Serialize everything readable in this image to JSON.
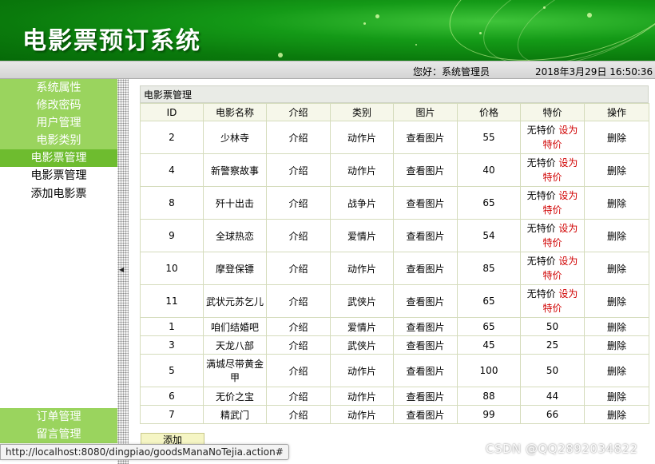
{
  "header": {
    "title": "电影票预订系统"
  },
  "infobar": {
    "greeting": "您好：系统管理员",
    "datetime": "2018年3月29日 16:50:36"
  },
  "sidebar": {
    "items": [
      {
        "label": "系统属性"
      },
      {
        "label": "修改密码"
      },
      {
        "label": "用户管理"
      },
      {
        "label": "电影类别"
      },
      {
        "label": "电影票管理"
      }
    ],
    "subitems": [
      {
        "label": "电影票管理"
      },
      {
        "label": "添加电影票"
      }
    ],
    "bottom_items": [
      {
        "label": "订单管理"
      },
      {
        "label": "留言管理"
      }
    ]
  },
  "main": {
    "section_title": "电影票管理",
    "columns": [
      "ID",
      "电影名称",
      "介绍",
      "类别",
      "图片",
      "价格",
      "特价",
      "操作"
    ],
    "intro_link": "介绍",
    "image_link": "查看图片",
    "no_special": "无特价",
    "set_special": "设为特价",
    "delete_link": "删除",
    "rows": [
      {
        "id": "2",
        "name": "少林寺",
        "category": "动作片",
        "price": "55",
        "special": ""
      },
      {
        "id": "4",
        "name": "新警察故事",
        "category": "动作片",
        "price": "40",
        "special": ""
      },
      {
        "id": "8",
        "name": "歼十出击",
        "category": "战争片",
        "price": "65",
        "special": ""
      },
      {
        "id": "9",
        "name": "全球热恋",
        "category": "爱情片",
        "price": "54",
        "special": ""
      },
      {
        "id": "10",
        "name": "摩登保镖",
        "category": "动作片",
        "price": "85",
        "special": ""
      },
      {
        "id": "11",
        "name": "武状元苏乞儿",
        "category": "武侠片",
        "price": "65",
        "special": ""
      },
      {
        "id": "1",
        "name": "咱们结婚吧",
        "category": "爱情片",
        "price": "65",
        "special": "50"
      },
      {
        "id": "3",
        "name": "天龙八部",
        "category": "武侠片",
        "price": "45",
        "special": "25"
      },
      {
        "id": "5",
        "name": "满城尽带黄金甲",
        "category": "动作片",
        "price": "100",
        "special": "50"
      },
      {
        "id": "6",
        "name": "无价之宝",
        "category": "动作片",
        "price": "88",
        "special": "44"
      },
      {
        "id": "7",
        "name": "精武门",
        "category": "动作片",
        "price": "99",
        "special": "66"
      }
    ],
    "add_button": "添加"
  },
  "statusbar": {
    "url": "http://localhost:8080/dingpiao/goodsManaNoTejia.action#"
  },
  "watermark": "CSDN @QQ2892034822"
}
